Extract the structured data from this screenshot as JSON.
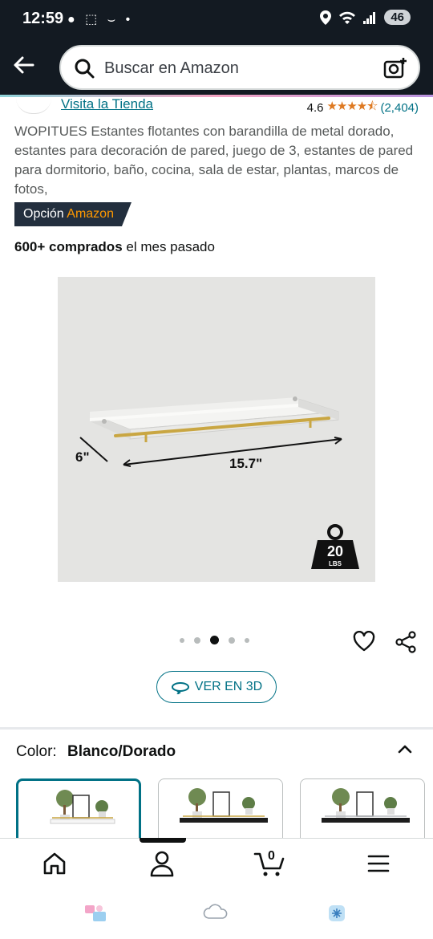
{
  "status": {
    "time": "12:59",
    "notif_icons": "● ⬚ ⌣ •",
    "battery": "46"
  },
  "search": {
    "placeholder": "Buscar en Amazon"
  },
  "product": {
    "store_link": "Visita la Tienda",
    "rating_value": "4.6",
    "stars": "★★★★⯪",
    "rating_count": "(2,404)",
    "title": "WOPITUES Estantes flotantes con barandilla de metal dorado, estantes para decoración de pared, juego de 3, estantes de pared para dormitorio, baño, cocina, sala de estar, plantas, marcos de fotos,",
    "badge_prefix": "Opción",
    "badge_brand": "Amazon",
    "bought_bold": "600+ comprados",
    "bought_rest": "el mes pasado",
    "image": {
      "depth_label": "6\"",
      "width_label": "15.7\"",
      "weight_value": "20",
      "weight_unit": "LBS"
    },
    "carousel_active_index": 2,
    "carousel_count": 5,
    "view3d_label": "VER EN 3D"
  },
  "color": {
    "label": "Color:",
    "value": "Blanco/Dorado",
    "options": [
      "Blanco/Dorado",
      "Negro/Dorado",
      "Negro/Plata"
    ]
  },
  "colors": {
    "accent_teal": "#007185",
    "header_bg": "#131a22",
    "badge_bg": "#232f3e",
    "amazon_orange": "#ff9900",
    "star": "#de7921"
  },
  "nav": {
    "cart_count": "0"
  }
}
